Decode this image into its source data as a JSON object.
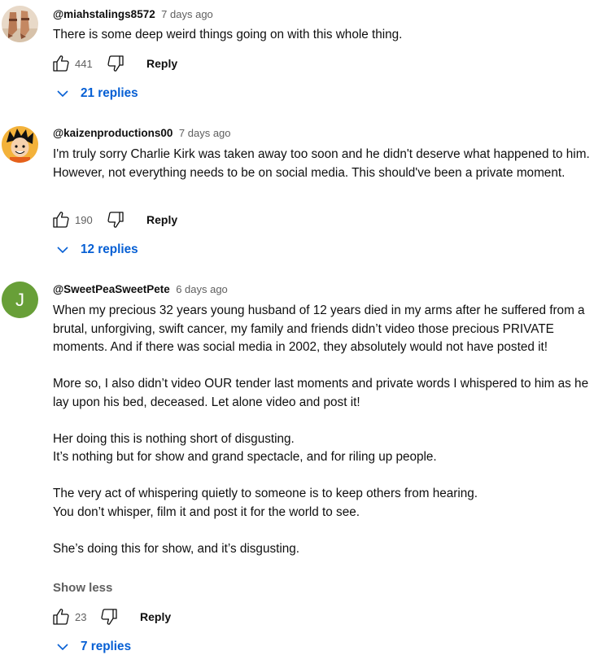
{
  "comments": [
    {
      "handle": "@miahstalings8572",
      "time": "7 days ago",
      "avatar": "photo-avatar-feet",
      "lines": [
        "There is some deep weird things going on with this whole thing."
      ],
      "likes": "441",
      "reply_label": "Reply",
      "replies_label": "21 replies"
    },
    {
      "handle": "@kaizenproductions00",
      "time": "7 days ago",
      "avatar": "cartoon-avatar",
      "lines": [
        "I'm truly sorry Charlie Kirk was taken away too soon and he didn't deserve what happened to him.",
        "However, not everything needs to be on social media. This should've been a private moment."
      ],
      "likes": "190",
      "reply_label": "Reply",
      "replies_label": "12 replies"
    },
    {
      "handle": "@SweetPeaSweetPete",
      "time": "6 days ago",
      "avatar_letter": "J",
      "avatar_color": "#689f38",
      "paragraphs": [
        "When my precious 32 years young husband of 12 years died in my arms after he suffered from a brutal, unforgiving, swift cancer, my family and friends didn’t video those precious PRIVATE moments. And if there was social media in 2002, they absolutely would not have posted it!",
        "More so, I also didn’t video OUR tender last moments and private words I whispered to him as he lay upon his bed, deceased. Let alone video and post it!",
        "Her doing this is nothing short of disgusting.\nIt’s nothing but for show and grand spectacle, and for riling   up people.",
        "The very act of whispering quietly to someone is to keep others from hearing.\nYou don’t whisper, film it and post it for the world to see.",
        "She’s doing this for show, and it’s disgusting."
      ],
      "show_less": "Show less",
      "likes": "23",
      "reply_label": "Reply",
      "replies_label": "7 replies"
    }
  ],
  "colors": {
    "link": "#065fd4",
    "secondary": "#606060",
    "text": "#0f0f0f"
  }
}
